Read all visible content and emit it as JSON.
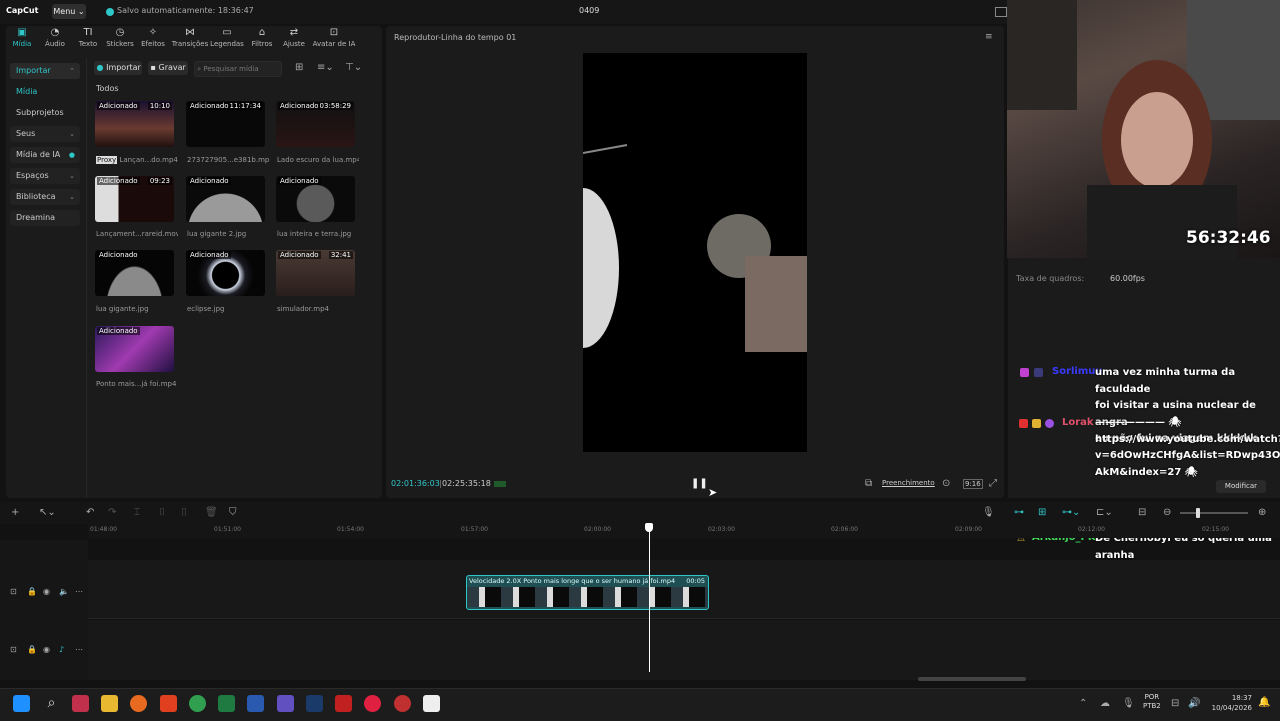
{
  "app": {
    "logo": "CapCut",
    "menu_label": "Menu",
    "autosave_text": "Salvo automaticamente: 18:36:47",
    "project_name": "0409"
  },
  "toolbar": [
    {
      "label": "Mídia",
      "icon": "media-icon"
    },
    {
      "label": "Áudio",
      "icon": "audio-icon"
    },
    {
      "label": "Texto",
      "icon": "text-icon"
    },
    {
      "label": "Stickers",
      "icon": "sticker-icon"
    },
    {
      "label": "Efeitos",
      "icon": "effects-icon"
    },
    {
      "label": "Transições",
      "icon": "transitions-icon"
    },
    {
      "label": "Legendas",
      "icon": "captions-icon"
    },
    {
      "label": "Filtros",
      "icon": "filters-icon"
    },
    {
      "label": "Ajuste",
      "icon": "adjust-icon"
    },
    {
      "label": "Avatar de IA",
      "icon": "ai-avatar-icon"
    }
  ],
  "sidebar": {
    "items": [
      {
        "label": "Importar"
      },
      {
        "label": "Mídia"
      },
      {
        "label": "Subprojetos"
      },
      {
        "label": "Seus"
      },
      {
        "label": "Mídia de IA"
      },
      {
        "label": "Espaços"
      },
      {
        "label": "Biblioteca"
      },
      {
        "label": "Dreamina"
      }
    ]
  },
  "media": {
    "import_label": "Importar",
    "record_label": "Gravar",
    "search_placeholder": "Pesquisar mídia",
    "group_label": "Todos",
    "items": [
      {
        "badge": "Adicionado",
        "duration": "10:10",
        "name": "Lançan...do.mp4",
        "proxy": "Proxy"
      },
      {
        "badge": "Adicionado",
        "duration": "11:17:34",
        "name": "273727905...e381b.mp4"
      },
      {
        "badge": "Adicionado",
        "duration": "03:58:29",
        "name": "Lado escuro da lua.mp4"
      },
      {
        "badge": "Adicionado",
        "duration": "09:23",
        "name": "Lançament...rareid.mov"
      },
      {
        "badge": "Adicionado",
        "duration": "",
        "name": "lua gigante 2.jpg"
      },
      {
        "badge": "Adicionado",
        "duration": "",
        "name": "lua inteira e terra.jpg"
      },
      {
        "badge": "Adicionado",
        "duration": "",
        "name": "lua gigante.jpg"
      },
      {
        "badge": "Adicionado",
        "duration": "",
        "name": "eclipse.jpg"
      },
      {
        "badge": "Adicionado",
        "duration": "32:41",
        "name": "simulador.mp4"
      },
      {
        "badge": "Adicionado",
        "duration": "",
        "name": "Ponto mais...já foi.mp4"
      }
    ]
  },
  "player": {
    "title": "Reprodutor-Linha do tempo 01",
    "current_time": "02:01:36:03",
    "total_time": "02:25:35:18",
    "fit_label": "Preenchimento",
    "ratio_label": "9:16"
  },
  "properties": {
    "fps_label": "Taxa de quadros:",
    "fps_value": "60.00fps",
    "modify_label": "Modificar"
  },
  "stream": {
    "timer": "56:32:46",
    "chat": [
      {
        "user": "Sorlimuu",
        "user_color": "#3a3aff",
        "lines": [
          "uma vez minha turma da faculdade",
          "foi visitar a usina nuclear de angra",
          "eu não fui na viagem kkkkkk"
        ]
      },
      {
        "user": "Lorak",
        "user_color": "#e0506a",
        "lines": [
          "——————— 🕷",
          "https://www.youtube.com/watch?",
          "v=6dOwHzCHfgA&list=RDwp43OdtA",
          "AkM&index=27 🕷"
        ]
      },
      {
        "user": "Arkanjo_PK",
        "user_color": "#3fdc5a",
        "lines": [
          "De Chernobyl eu só queria uma",
          "aranha"
        ]
      }
    ]
  },
  "timeline": {
    "ticks": [
      "01:48:00",
      "01:51:00",
      "01:54:00",
      "01:57:00",
      "02:00:00",
      "02:03:00",
      "02:06:00",
      "02:09:00",
      "02:12:00",
      "02:15:00"
    ],
    "clip_label": "Velocidade 2.0X   Ponto mais longe que o ser humano já foi.mp4",
    "clip_duration": "00:05"
  },
  "taskbar": {
    "lang_line1": "POR",
    "lang_line2": "PTB2",
    "time": "18:37",
    "date": "10/04/2026"
  },
  "colors": {
    "accent": "#2fc6c8",
    "background": "#121212",
    "panel": "#1b1b1b"
  }
}
